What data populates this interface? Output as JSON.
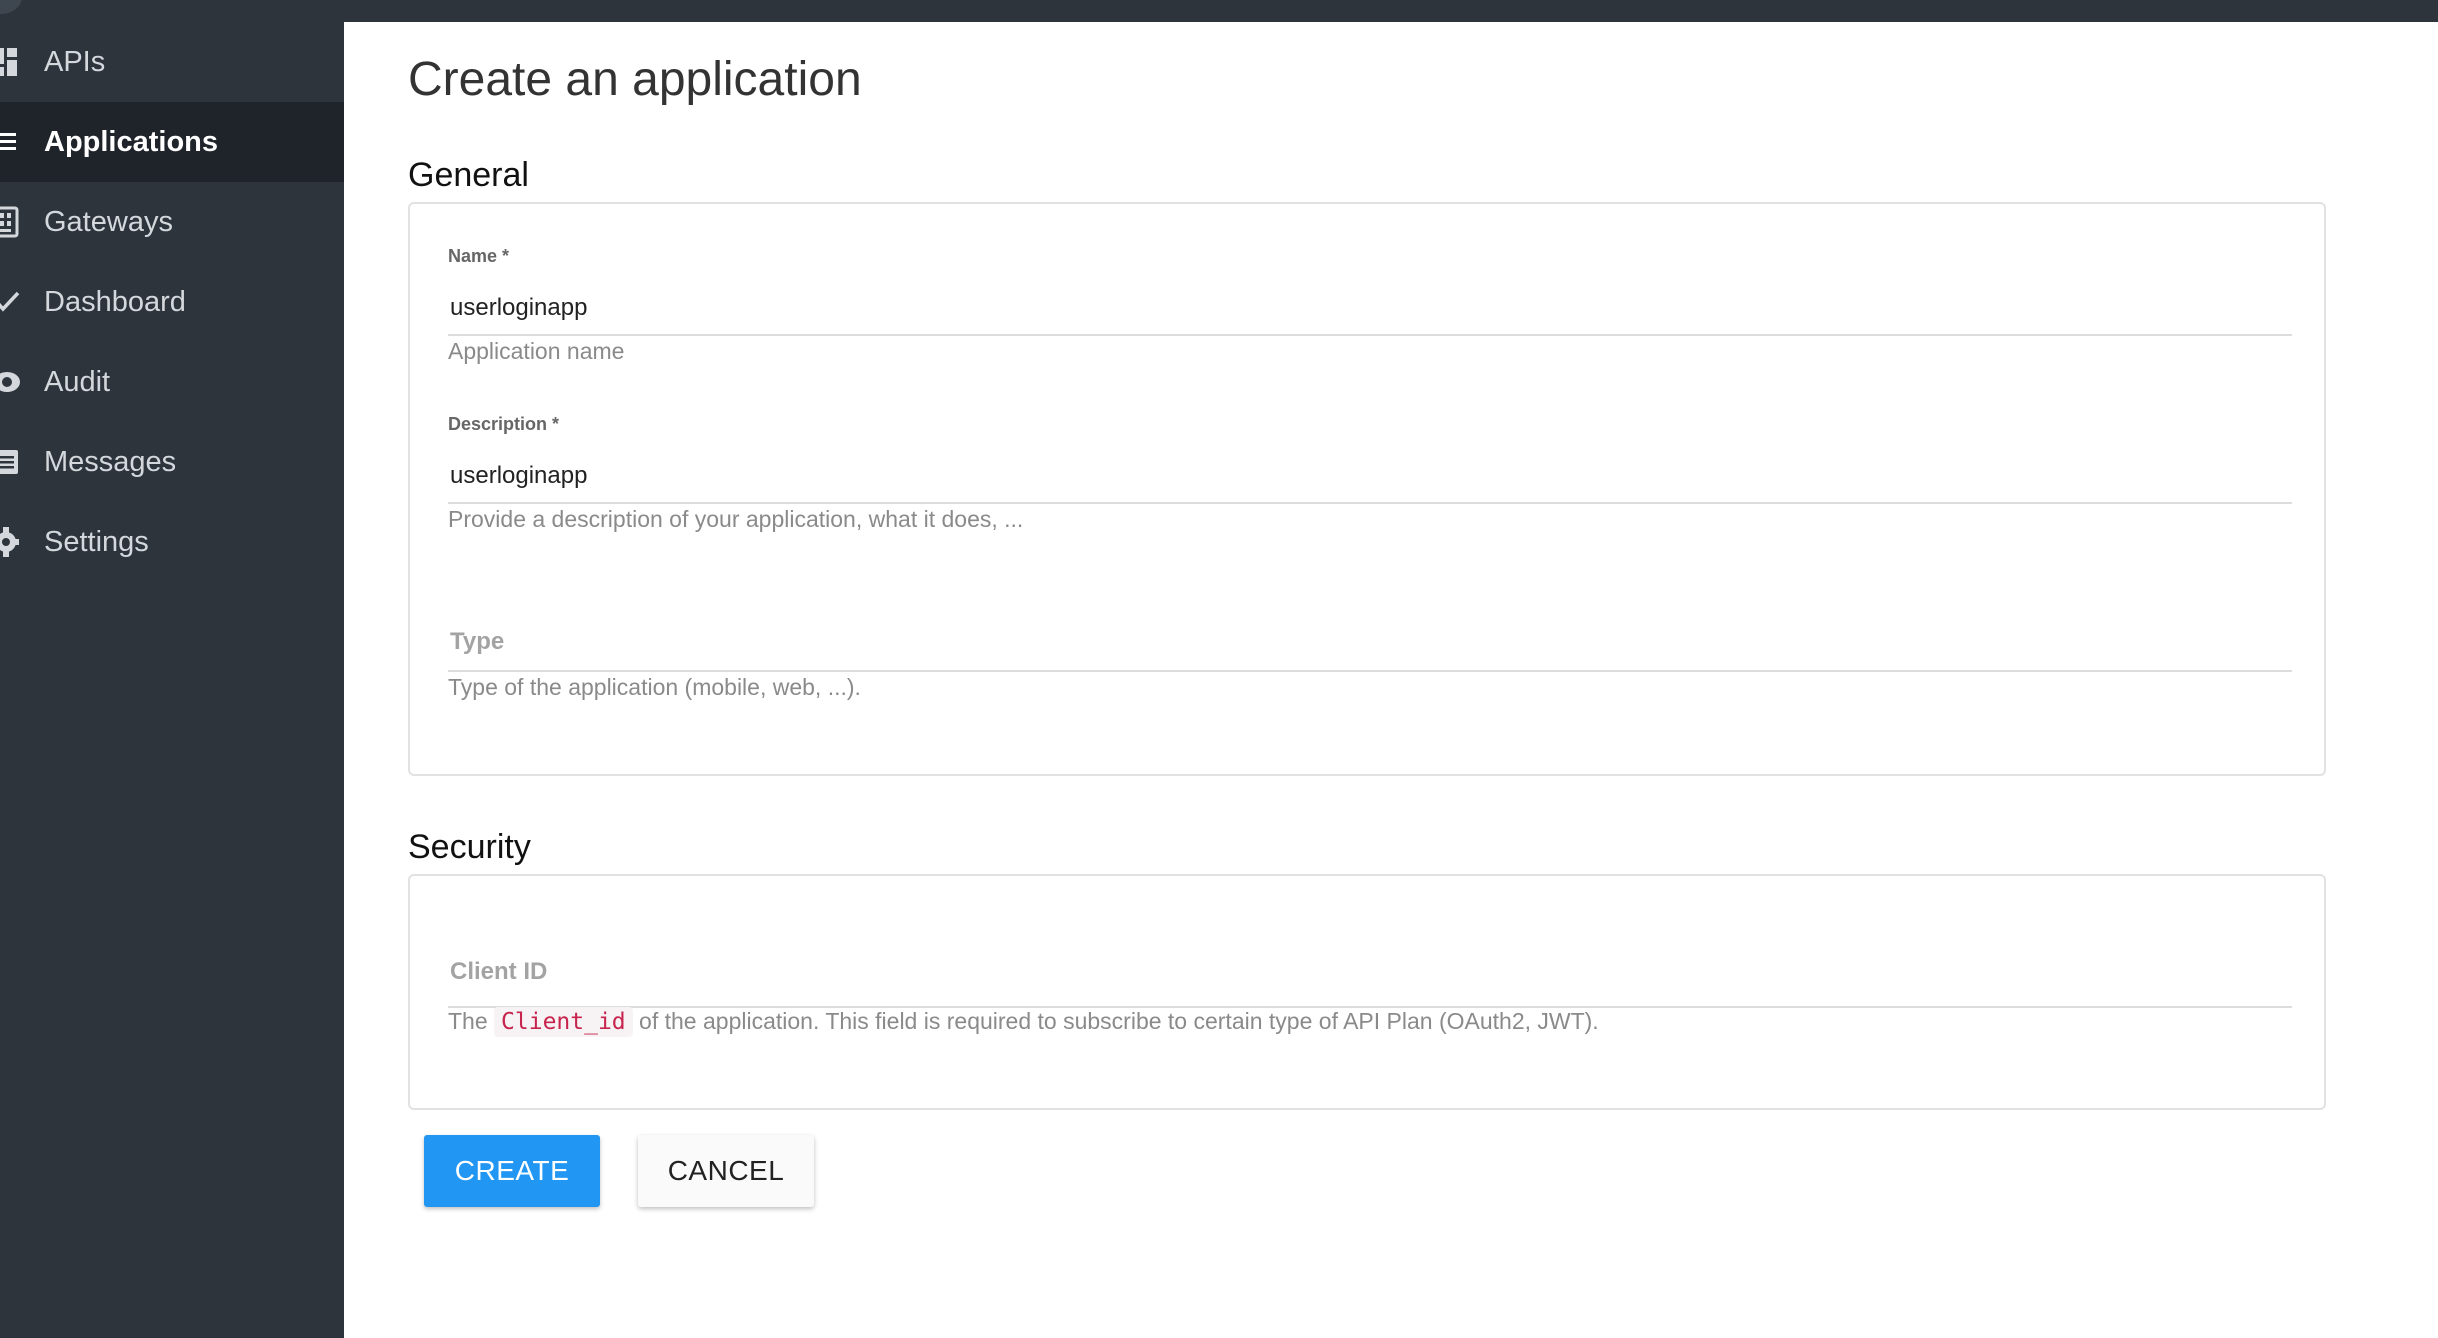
{
  "sidebar": {
    "items": [
      {
        "label": "APIs",
        "icon": "dashboard-grid-icon",
        "active": false
      },
      {
        "label": "Applications",
        "icon": "list-icon",
        "active": true
      },
      {
        "label": "Gateways",
        "icon": "gateway-icon",
        "active": false
      },
      {
        "label": "Dashboard",
        "icon": "checkmark-icon",
        "active": false
      },
      {
        "label": "Audit",
        "icon": "eye-icon",
        "active": false
      },
      {
        "label": "Messages",
        "icon": "message-icon",
        "active": false
      },
      {
        "label": "Settings",
        "icon": "gear-icon",
        "active": false
      }
    ]
  },
  "main": {
    "title": "Create an application",
    "general": {
      "heading": "General",
      "name": {
        "label": "Name *",
        "value": "userloginapp",
        "hint": "Application name"
      },
      "description": {
        "label": "Description *",
        "value": "userloginapp",
        "hint": "Provide a description of your application, what it does, ..."
      },
      "type": {
        "placeholder": "Type",
        "hint": "Type of the application (mobile, web, ...)."
      }
    },
    "security": {
      "heading": "Security",
      "client_id": {
        "placeholder": "Client ID",
        "hint_prefix": "The",
        "hint_code": "Client_id",
        "hint_suffix": "of the application. This field is required to subscribe to certain type of API Plan (OAuth2, JWT)."
      }
    },
    "actions": {
      "create": "CREATE",
      "cancel": "CANCEL"
    }
  },
  "colors": {
    "sidebar_bg": "#2d343c",
    "active_bg": "#1f242a",
    "primary": "#2196f3",
    "code": "#c7254e"
  }
}
